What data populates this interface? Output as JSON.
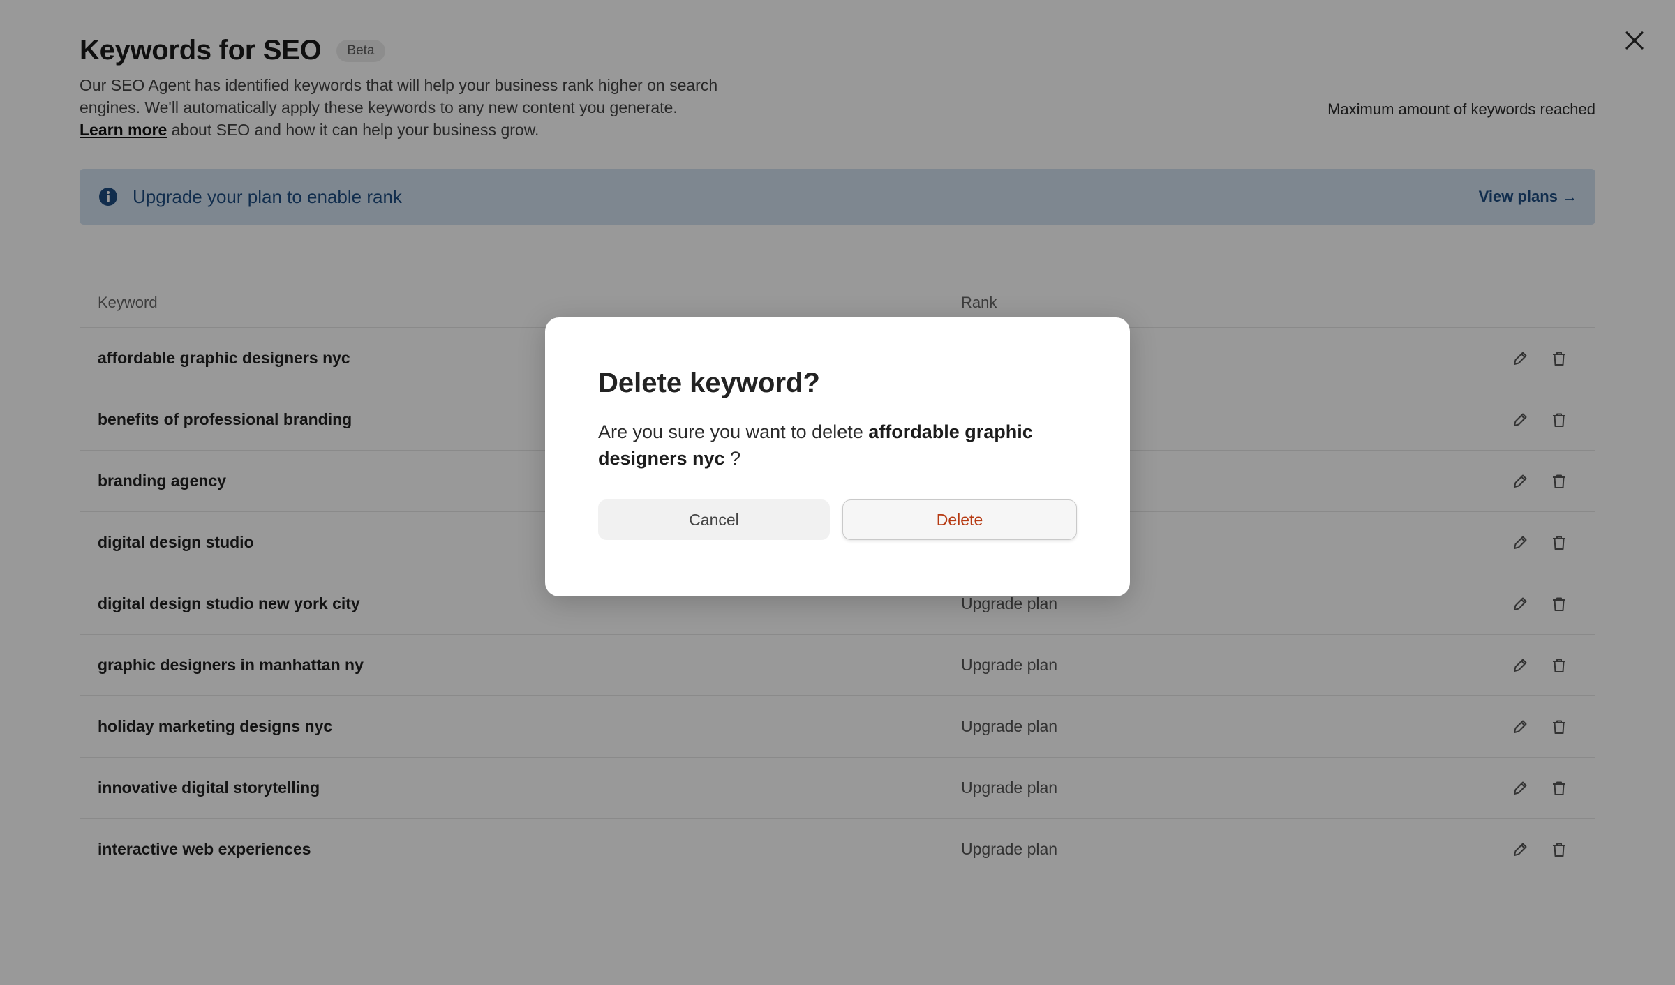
{
  "header": {
    "title": "Keywords for SEO",
    "badge": "Beta",
    "desc_line1": "Our SEO Agent has identified keywords that will help your business rank higher on search",
    "desc_line2": "engines. We'll automatically apply these keywords to any new content you generate.",
    "learn_more": "Learn more",
    "desc_line3": " about SEO and how it can help your business grow.",
    "max_note": "Maximum amount of keywords reached"
  },
  "banner": {
    "message": "Upgrade your plan to enable rank",
    "link": "View plans →",
    "color": "#1d4c80"
  },
  "table": {
    "col_keyword": "Keyword",
    "col_rank": "Rank",
    "rows": [
      {
        "keyword": "affordable graphic designers nyc",
        "rank": ""
      },
      {
        "keyword": "benefits of professional branding",
        "rank": ""
      },
      {
        "keyword": "branding agency",
        "rank": ""
      },
      {
        "keyword": "digital design studio",
        "rank": ""
      },
      {
        "keyword": "digital design studio new york city",
        "rank": "Upgrade plan"
      },
      {
        "keyword": "graphic designers in manhattan ny",
        "rank": "Upgrade plan"
      },
      {
        "keyword": "holiday marketing designs nyc",
        "rank": "Upgrade plan"
      },
      {
        "keyword": "innovative digital storytelling",
        "rank": "Upgrade plan"
      },
      {
        "keyword": "interactive web experiences",
        "rank": "Upgrade plan"
      }
    ]
  },
  "modal": {
    "title": "Delete keyword?",
    "body_prefix": "Are you sure you want to delete ",
    "keyword": "affordable graphic designers nyc",
    "body_suffix": " ?",
    "cancel_label": "Cancel",
    "delete_label": "Delete",
    "delete_color": "#b63a12"
  }
}
